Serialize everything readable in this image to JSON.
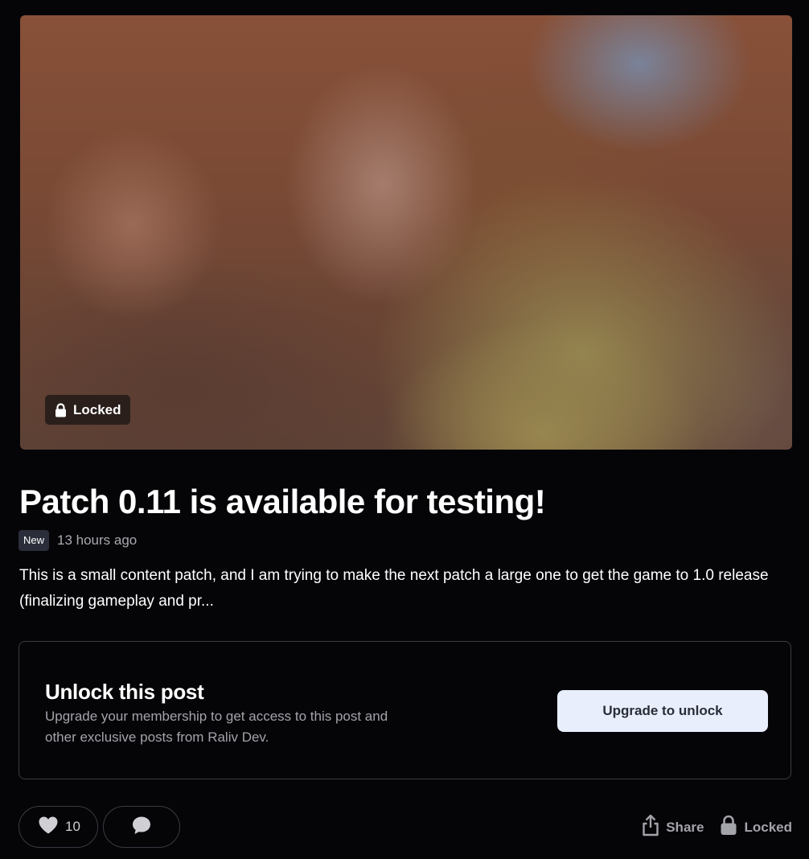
{
  "hero": {
    "locked_label": "Locked",
    "lock_icon": "lock-icon"
  },
  "post": {
    "title": "Patch 0.11 is available for testing!",
    "badge": "New",
    "timestamp": "13 hours ago",
    "excerpt": "This is a small content patch, and I am trying to make the next patch a large one to get the game to 1.0 release (finalizing gameplay and pr..."
  },
  "unlock": {
    "title": "Unlock this post",
    "description": "Upgrade your membership to get access to this post and other exclusive posts from Raliv Dev.",
    "button_label": "Upgrade to unlock"
  },
  "actions": {
    "like_count": "10",
    "like_icon": "heart-icon",
    "comment_icon": "comment-icon",
    "share_label": "Share",
    "share_icon": "share-icon",
    "locked_label": "Locked",
    "locked_icon": "lock-icon"
  },
  "colors": {
    "background": "#050508",
    "button_bg": "#e8eefc",
    "muted_text": "#a3a3aa",
    "border": "#3a3a42"
  }
}
